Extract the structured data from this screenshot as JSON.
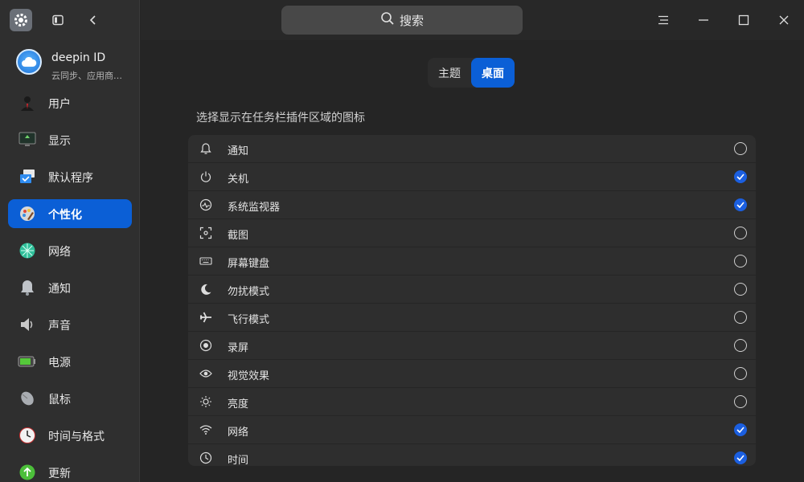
{
  "window": {
    "search_label": "搜索"
  },
  "account": {
    "name": "deepin ID",
    "subtitle": "云同步、应用商…"
  },
  "sidebar": {
    "items": [
      {
        "label": "用户",
        "icon": "user-icon",
        "active": false
      },
      {
        "label": "显示",
        "icon": "display-icon",
        "active": false
      },
      {
        "label": "默认程序",
        "icon": "default-apps-icon",
        "active": false
      },
      {
        "label": "个性化",
        "icon": "personalization-icon",
        "active": true
      },
      {
        "label": "网络",
        "icon": "network-icon",
        "active": false
      },
      {
        "label": "通知",
        "icon": "notification-icon",
        "active": false
      },
      {
        "label": "声音",
        "icon": "sound-icon",
        "active": false
      },
      {
        "label": "电源",
        "icon": "power-battery-icon",
        "active": false
      },
      {
        "label": "鼠标",
        "icon": "mouse-icon",
        "active": false
      },
      {
        "label": "时间与格式",
        "icon": "clock-icon",
        "active": false
      },
      {
        "label": "更新",
        "icon": "update-icon",
        "active": false
      }
    ]
  },
  "tabs": [
    {
      "label": "主题",
      "active": false
    },
    {
      "label": "桌面",
      "active": true
    }
  ],
  "section_title": "选择显示在任务栏插件区域的图标",
  "plugins": [
    {
      "label": "通知",
      "icon": "bell-icon",
      "checked": false
    },
    {
      "label": "关机",
      "icon": "power-icon",
      "checked": true
    },
    {
      "label": "系统监视器",
      "icon": "system-monitor-icon",
      "checked": true
    },
    {
      "label": "截图",
      "icon": "screenshot-icon",
      "checked": false
    },
    {
      "label": "屏幕键盘",
      "icon": "keyboard-icon",
      "checked": false
    },
    {
      "label": "勿扰模式",
      "icon": "moon-icon",
      "checked": false
    },
    {
      "label": "飞行模式",
      "icon": "airplane-icon",
      "checked": false
    },
    {
      "label": "录屏",
      "icon": "record-icon",
      "checked": false
    },
    {
      "label": "视觉效果",
      "icon": "eye-icon",
      "checked": false
    },
    {
      "label": "亮度",
      "icon": "brightness-icon",
      "checked": false
    },
    {
      "label": "网络",
      "icon": "wifi-icon",
      "checked": true
    },
    {
      "label": "时间",
      "icon": "time-icon",
      "checked": true
    }
  ],
  "colors": {
    "accent": "#0b5fd6",
    "check": "#1b5fe0"
  }
}
